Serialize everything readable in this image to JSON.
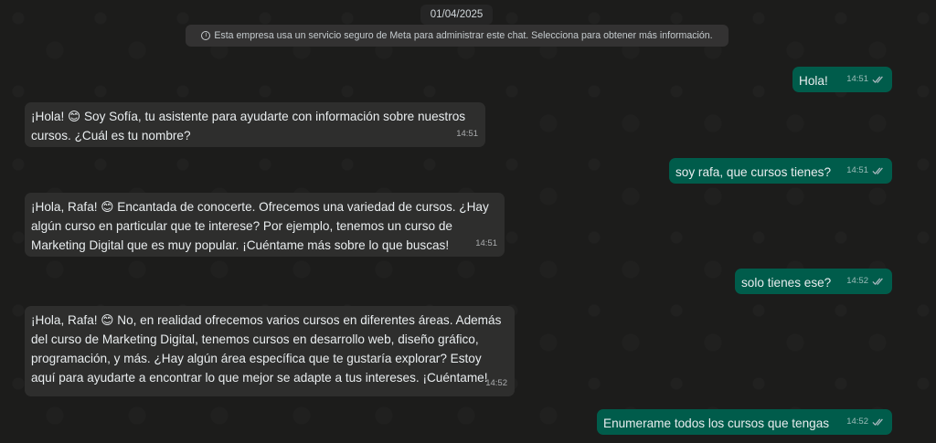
{
  "date_label": "01/04/2025",
  "notice": "Esta empresa usa un servicio seguro de Meta para administrar este chat. Selecciona para obtener más información.",
  "icons": {
    "info": "info-icon",
    "read": "double-check-icon"
  },
  "colors": {
    "incoming": "#2e2e2d",
    "outgoing": "#005c4b",
    "background": "#1c1c1b"
  },
  "messages": [
    {
      "direction": "out",
      "lines": [
        "Hola!"
      ],
      "time": "14:51"
    },
    {
      "direction": "in",
      "lines": [
        "¡Hola! 😊 Soy Sofía, tu asistente para ayudarte con información sobre nuestros",
        "cursos. ¿Cuál es tu nombre?"
      ],
      "time": "14:51"
    },
    {
      "direction": "out",
      "lines": [
        "soy rafa, que cursos tienes?"
      ],
      "time": "14:51"
    },
    {
      "direction": "in",
      "lines": [
        "¡Hola, Rafa! 😊 Encantada de conocerte. Ofrecemos una variedad de cursos. ¿Hay",
        "algún curso en particular que te interese? Por ejemplo, tenemos un curso de",
        "Marketing Digital que es muy popular. ¡Cuéntame más sobre lo que buscas!"
      ],
      "time": "14:51"
    },
    {
      "direction": "out",
      "lines": [
        "solo tienes ese?"
      ],
      "time": "14:52"
    },
    {
      "direction": "in",
      "lines": [
        "¡Hola, Rafa! 😊 No, en realidad ofrecemos varios cursos en diferentes áreas. Además",
        "del curso de Marketing Digital, tenemos cursos en desarrollo web, diseño gráfico,",
        "programación, y más. ¿Hay algún área específica que te gustaría explorar? Estoy",
        "aquí para ayudarte a encontrar lo que mejor se adapte a tus intereses. ¡Cuéntame!"
      ],
      "time": "14:52"
    },
    {
      "direction": "out",
      "lines": [
        "Enumerame todos los cursos que tengas"
      ],
      "time": "14:52"
    }
  ]
}
